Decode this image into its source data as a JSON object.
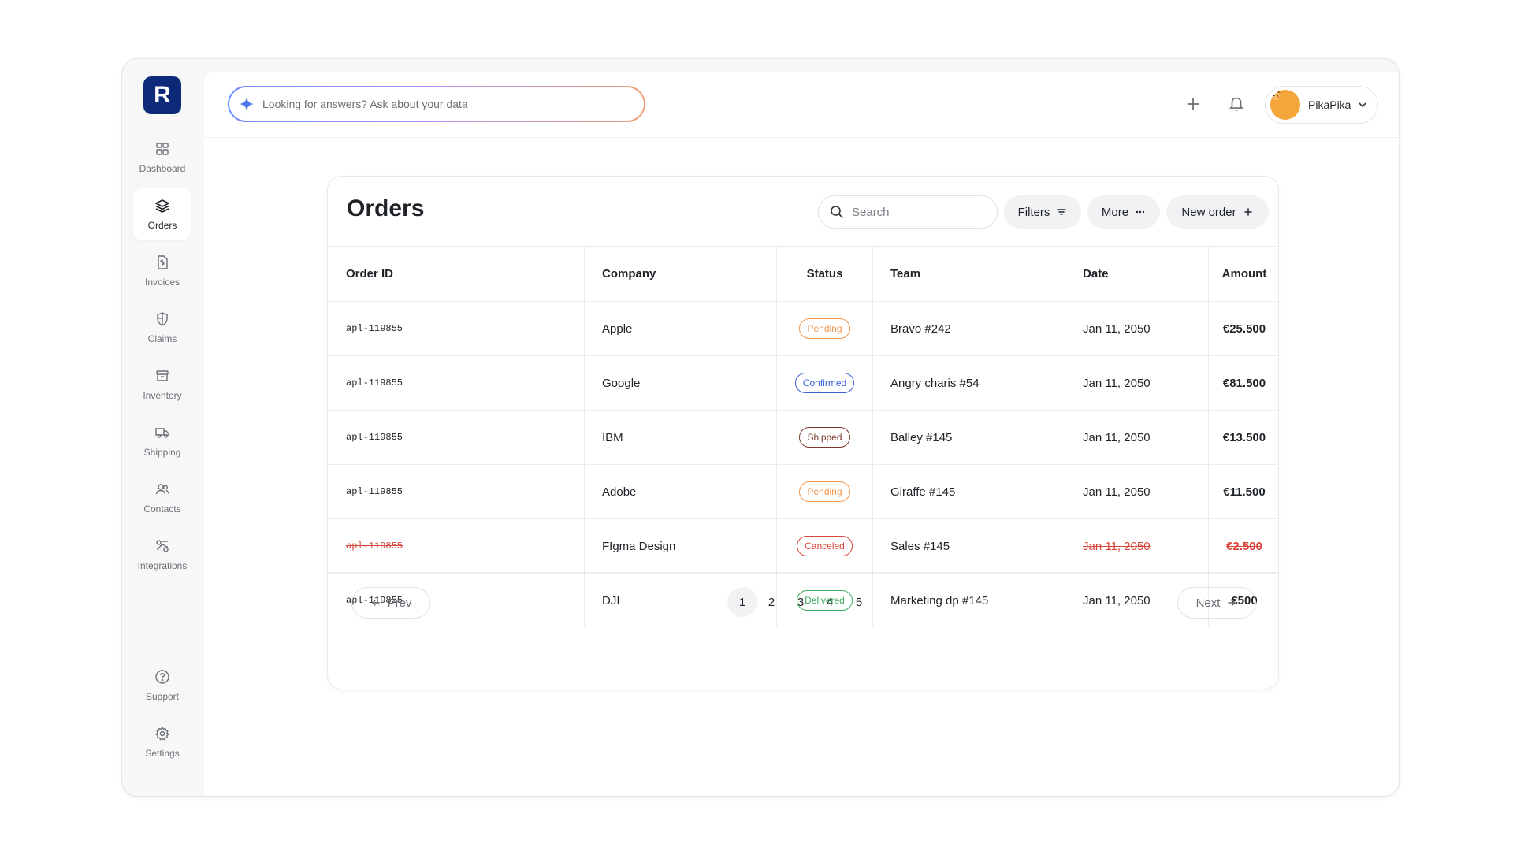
{
  "brand": {
    "logo_letter": "R",
    "color": "#0c2a78"
  },
  "sidebar": {
    "items": [
      {
        "label": "Dashboard",
        "icon": "dashboard-icon"
      },
      {
        "label": "Orders",
        "icon": "layers-icon",
        "active": true
      },
      {
        "label": "Invoices",
        "icon": "invoice-icon"
      },
      {
        "label": "Claims",
        "icon": "shield-icon"
      },
      {
        "label": "Inventory",
        "icon": "archive-icon"
      },
      {
        "label": "Shipping",
        "icon": "truck-icon"
      },
      {
        "label": "Contacts",
        "icon": "users-icon"
      },
      {
        "label": "Integrations",
        "icon": "integrations-icon"
      }
    ],
    "bottom": [
      {
        "label": "Support",
        "icon": "help-icon"
      },
      {
        "label": "Settings",
        "icon": "gear-icon"
      }
    ]
  },
  "topbar": {
    "ask_placeholder": "Looking for answers? Ask about your data",
    "user_name": "PikaPika"
  },
  "orders": {
    "title": "Orders",
    "search_placeholder": "Search",
    "filters_label": "Filters",
    "more_label": "More",
    "new_order_label": "New order",
    "columns": [
      "Order ID",
      "Company",
      "Status",
      "Team",
      "Date",
      "Amount"
    ],
    "rows": [
      {
        "id": "apl-119855",
        "company": "Apple",
        "status": "Pending",
        "team": "Bravo #242",
        "date": "Jan 11, 2050",
        "amount": "€25.500",
        "canceled": false
      },
      {
        "id": "apl-119855",
        "company": "Google",
        "status": "Confirmed",
        "team": "Angry charis #54",
        "date": "Jan 11, 2050",
        "amount": "€81.500",
        "canceled": false
      },
      {
        "id": "apl-119855",
        "company": "IBM",
        "status": "Shipped",
        "team": "Balley #145",
        "date": "Jan 11, 2050",
        "amount": "€13.500",
        "canceled": false
      },
      {
        "id": "apl-119855",
        "company": "Adobe",
        "status": "Pending",
        "team": "Giraffe #145",
        "date": "Jan 11, 2050",
        "amount": "€11.500",
        "canceled": false
      },
      {
        "id": "apl-119855",
        "company": "FIgma Design",
        "status": "Canceled",
        "team": "Sales #145",
        "date": "Jan 11, 2050",
        "amount": "€2.500",
        "canceled": true
      },
      {
        "id": "apl-119855",
        "company": "DJI",
        "status": "Delivered",
        "team": "Marketing dp #145",
        "date": "Jan 11, 2050",
        "amount": "€500",
        "canceled": false
      }
    ],
    "status_colors": {
      "Pending": "#f0944a",
      "Confirmed": "#3a5fd9",
      "Shipped": "#7a3a2a",
      "Canceled": "#d8453a",
      "Delivered": "#3fae62"
    }
  },
  "pagination": {
    "prev_label": "Prev",
    "next_label": "Next",
    "pages": [
      "1",
      "2",
      "3",
      "4",
      "5"
    ],
    "current": "1"
  }
}
